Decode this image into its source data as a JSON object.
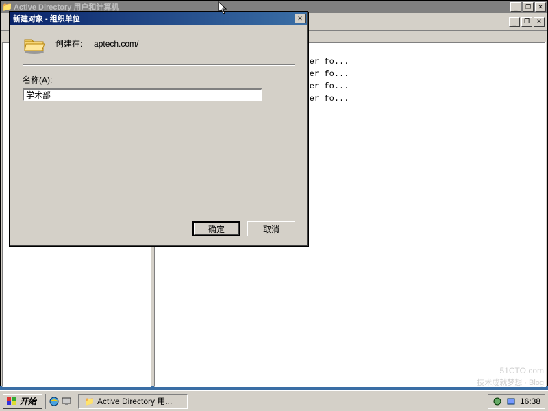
{
  "main_window": {
    "title": "Active Directory 用户和计算机"
  },
  "list": {
    "rows": [
      "t container fo...",
      "t container fo...",
      "t container fo...",
      "t container fo..."
    ]
  },
  "dialog": {
    "title": "新建对象 - 组织单位",
    "created_in_label": "创建在:",
    "created_in_value": "aptech.com/",
    "name_label": "名称(A):",
    "name_value": "学术部",
    "ok_label": "确定",
    "cancel_label": "取消"
  },
  "taskbar": {
    "start_label": "开始",
    "app_label": "Active Directory 用...",
    "time": "16:38"
  },
  "watermark": {
    "main": "51CTO.com",
    "sub": "技术成就梦想 · Blog"
  }
}
